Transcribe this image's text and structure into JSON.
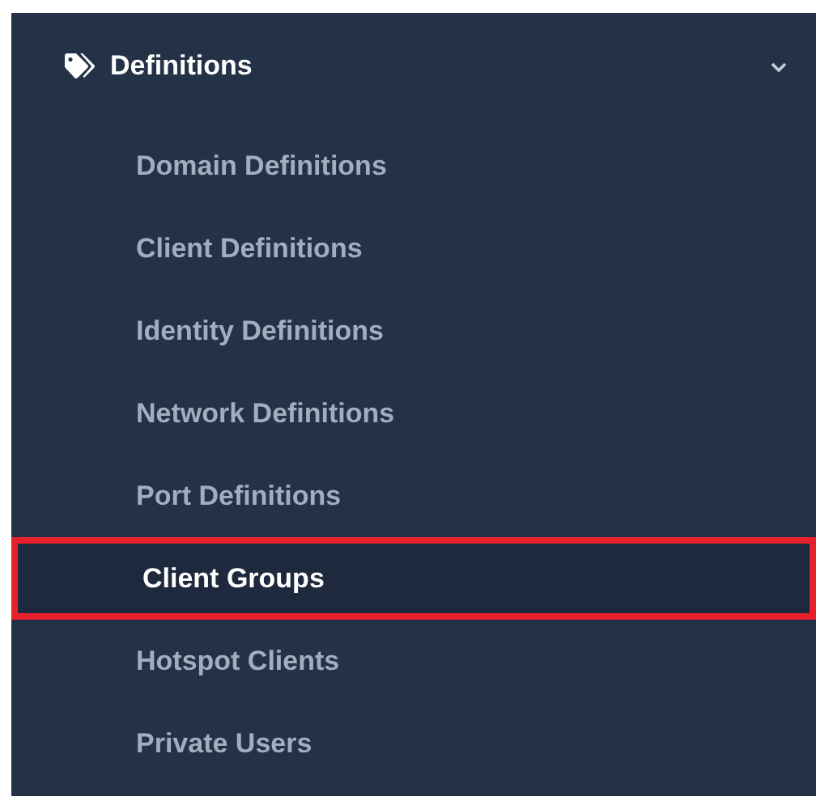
{
  "menu": {
    "title": "Definitions",
    "expanded": true,
    "items": [
      {
        "label": "Domain Definitions",
        "selected": false,
        "highlighted": false
      },
      {
        "label": "Client Definitions",
        "selected": false,
        "highlighted": false
      },
      {
        "label": "Identity Definitions",
        "selected": false,
        "highlighted": false
      },
      {
        "label": "Network Definitions",
        "selected": false,
        "highlighted": false
      },
      {
        "label": "Port Definitions",
        "selected": false,
        "highlighted": false
      },
      {
        "label": "Client Groups",
        "selected": true,
        "highlighted": true
      },
      {
        "label": "Hotspot Clients",
        "selected": false,
        "highlighted": false
      },
      {
        "label": "Private Users",
        "selected": false,
        "highlighted": false
      }
    ]
  }
}
